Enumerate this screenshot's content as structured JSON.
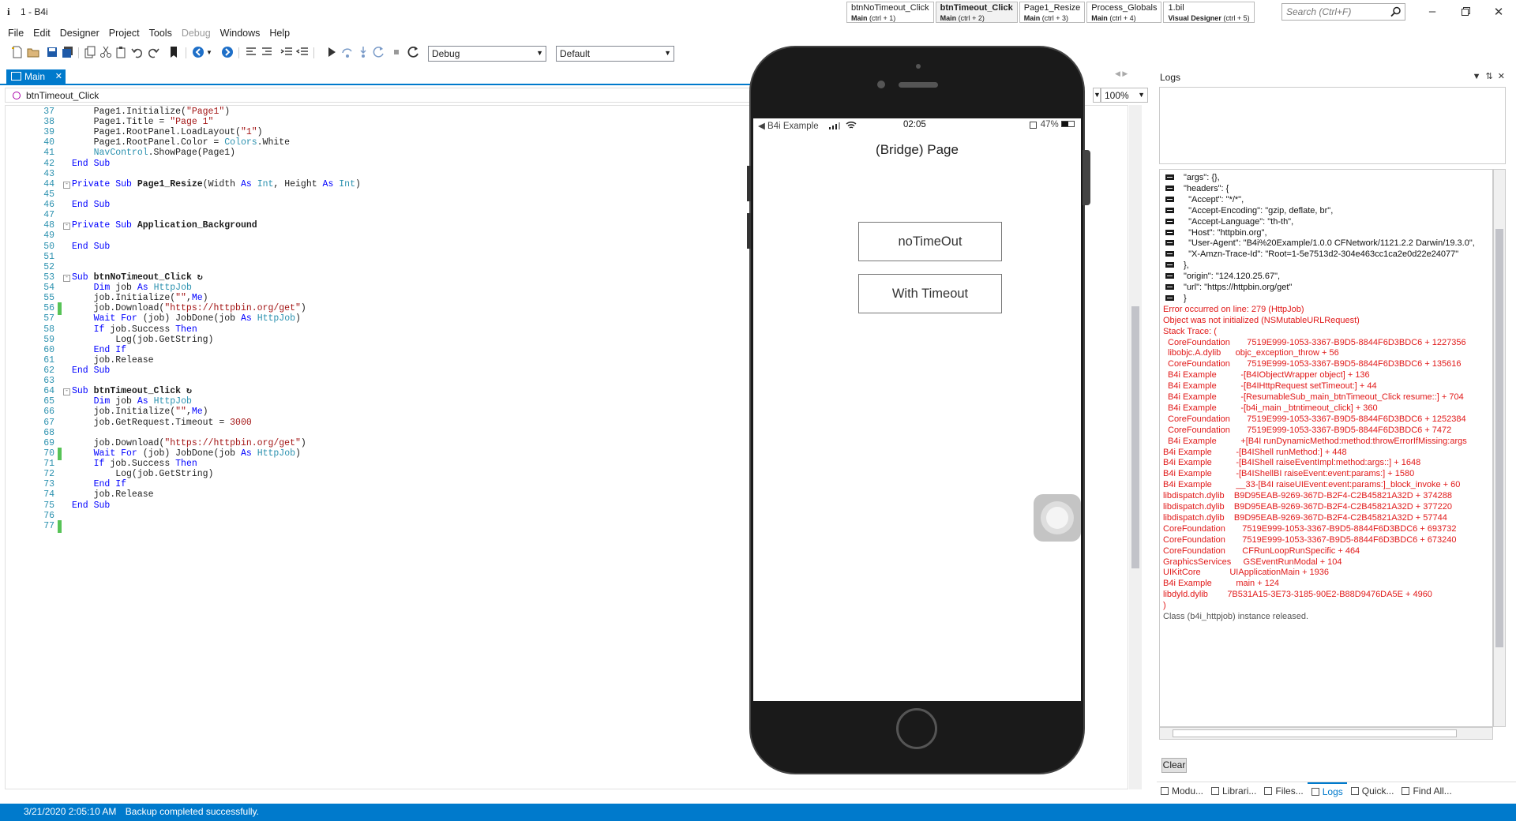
{
  "window": {
    "icon": "i",
    "title": "1 - B4i"
  },
  "quick_tabs": [
    {
      "title": "btnNoTimeout_Click",
      "module": "Main",
      "shortcut": "(ctrl + 1)"
    },
    {
      "title": "btnTimeout_Click",
      "module": "Main",
      "shortcut": "(ctrl + 2)"
    },
    {
      "title": "Page1_Resize",
      "module": "Main",
      "shortcut": "(ctrl + 3)"
    },
    {
      "title": "Process_Globals",
      "module": "Main",
      "shortcut": "(ctrl + 4)"
    },
    {
      "title": "1.bil",
      "module": "Visual Designer",
      "shortcut": "(ctrl + 5)"
    }
  ],
  "search": {
    "placeholder": "Search (Ctrl+F)"
  },
  "menu": [
    "File",
    "Edit",
    "Designer",
    "Project",
    "Tools",
    "Debug",
    "Windows",
    "Help"
  ],
  "toolbar": {
    "build_config": "Debug",
    "platform": "Default"
  },
  "editor": {
    "tab_label": "Main",
    "sub_selector": "btnTimeout_Click",
    "zoom": "100%",
    "lines": [
      {
        "n": "37",
        "t": "    Page1.Initialize(\"Page1\")"
      },
      {
        "n": "38",
        "t": "    Page1.Title = \"Page 1\""
      },
      {
        "n": "39",
        "t": "    Page1.RootPanel.LoadLayout(\"1\")"
      },
      {
        "n": "40",
        "t": "    Page1.RootPanel.Color = Colors.White"
      },
      {
        "n": "41",
        "t": "    NavControl.ShowPage(Page1)"
      },
      {
        "n": "42",
        "t": "End Sub"
      },
      {
        "n": "43",
        "t": ""
      },
      {
        "n": "44",
        "t": "Private Sub Page1_Resize(Width As Int, Height As Int)"
      },
      {
        "n": "45",
        "t": ""
      },
      {
        "n": "46",
        "t": "End Sub"
      },
      {
        "n": "47",
        "t": ""
      },
      {
        "n": "48",
        "t": "Private Sub Application_Background"
      },
      {
        "n": "49",
        "t": ""
      },
      {
        "n": "50",
        "t": "End Sub"
      },
      {
        "n": "51",
        "t": ""
      },
      {
        "n": "52",
        "t": ""
      },
      {
        "n": "53",
        "t": "Sub btnNoTimeout_Click"
      },
      {
        "n": "54",
        "t": "    Dim job As HttpJob"
      },
      {
        "n": "55",
        "t": "    job.Initialize(\"\",Me)"
      },
      {
        "n": "56",
        "t": "    job.Download(\"https://httpbin.org/get\")"
      },
      {
        "n": "57",
        "t": "    Wait For (job) JobDone(job As HttpJob)"
      },
      {
        "n": "58",
        "t": "    If job.Success Then"
      },
      {
        "n": "59",
        "t": "        Log(job.GetString)"
      },
      {
        "n": "60",
        "t": "    End If"
      },
      {
        "n": "61",
        "t": "    job.Release"
      },
      {
        "n": "62",
        "t": "End Sub"
      },
      {
        "n": "63",
        "t": ""
      },
      {
        "n": "64",
        "t": "Sub btnTimeout_Click"
      },
      {
        "n": "65",
        "t": "    Dim job As HttpJob"
      },
      {
        "n": "66",
        "t": "    job.Initialize(\"\",Me)"
      },
      {
        "n": "67",
        "t": "    job.GetRequest.Timeout = 3000"
      },
      {
        "n": "68",
        "t": ""
      },
      {
        "n": "69",
        "t": "    job.Download(\"https://httpbin.org/get\")"
      },
      {
        "n": "70",
        "t": "    Wait For (job) JobDone(job As HttpJob)"
      },
      {
        "n": "71",
        "t": "    If job.Success Then"
      },
      {
        "n": "72",
        "t": "        Log(job.GetString)"
      },
      {
        "n": "73",
        "t": "    End If"
      },
      {
        "n": "74",
        "t": "    job.Release"
      },
      {
        "n": "75",
        "t": "End Sub"
      },
      {
        "n": "76",
        "t": ""
      },
      {
        "n": "77",
        "t": ""
      }
    ]
  },
  "phone": {
    "status_back": "◀ B4i Example",
    "status_time": "02:05",
    "status_battery": "47%",
    "nav_title": "(Bridge) Page",
    "buttons": [
      "noTimeOut",
      "With Timeout"
    ]
  },
  "logs": {
    "title": "Logs",
    "clear_label": "Clear",
    "entries": [
      {
        "k": "ex",
        "t": "\"args\": {},"
      },
      {
        "k": "ex",
        "t": "\"headers\": {"
      },
      {
        "k": "ex",
        "t": "  \"Accept\": \"*/*\","
      },
      {
        "k": "ex",
        "t": "  \"Accept-Encoding\": \"gzip, deflate, br\","
      },
      {
        "k": "ex",
        "t": "  \"Accept-Language\": \"th-th\","
      },
      {
        "k": "ex",
        "t": "  \"Host\": \"httpbin.org\","
      },
      {
        "k": "ex",
        "t": "  \"User-Agent\": \"B4i%20Example/1.0.0 CFNetwork/1121.2.2 Darwin/19.3.0\","
      },
      {
        "k": "ex",
        "t": "  \"X-Amzn-Trace-Id\": \"Root=1-5e7513d2-304e463cc1ca2e0d22e24077\""
      },
      {
        "k": "ex",
        "t": "},"
      },
      {
        "k": "ex",
        "t": "\"origin\": \"124.120.25.67\","
      },
      {
        "k": "ex",
        "t": "\"url\": \"https://httpbin.org/get\""
      },
      {
        "k": "ex",
        "t": "}"
      },
      {
        "k": "err",
        "t": "Error occurred on line: 279 (HttpJob)"
      },
      {
        "k": "err",
        "t": "Object was not initialized (NSMutableURLRequest)"
      },
      {
        "k": "err",
        "t": "Stack Trace: ("
      },
      {
        "k": "erri",
        "t": "CoreFoundation       7519E999-1053-3367-B9D5-8844F6D3BDC6 + 1227356"
      },
      {
        "k": "erri",
        "t": "libobjc.A.dylib      objc_exception_throw + 56"
      },
      {
        "k": "erri",
        "t": "CoreFoundation       7519E999-1053-3367-B9D5-8844F6D3BDC6 + 135616"
      },
      {
        "k": "erri",
        "t": "B4i Example          -[B4IObjectWrapper object] + 136"
      },
      {
        "k": "erri",
        "t": "B4i Example          -[B4IHttpRequest setTimeout:] + 44"
      },
      {
        "k": "erri",
        "t": "B4i Example          -[ResumableSub_main_btnTimeout_Click resume::] + 704"
      },
      {
        "k": "erri",
        "t": "B4i Example          -[b4i_main _btntimeout_click] + 360"
      },
      {
        "k": "erri",
        "t": "CoreFoundation       7519E999-1053-3367-B9D5-8844F6D3BDC6 + 1252384"
      },
      {
        "k": "erri",
        "t": "CoreFoundation       7519E999-1053-3367-B9D5-8844F6D3BDC6 + 7472"
      },
      {
        "k": "erri",
        "t": "B4i Example          +[B4I runDynamicMethod:method:throwErrorIfMissing:args"
      },
      {
        "k": "err",
        "t": "B4i Example          -[B4IShell runMethod:] + 448"
      },
      {
        "k": "err",
        "t": "B4i Example          -[B4IShell raiseEventImpl:method:args::] + 1648"
      },
      {
        "k": "err",
        "t": "B4i Example          -[B4IShellBI raiseEvent:event:params:] + 1580"
      },
      {
        "k": "err",
        "t": "B4i Example          __33-[B4I raiseUIEvent:event:params:]_block_invoke + 60"
      },
      {
        "k": "err",
        "t": "libdispatch.dylib    B9D95EAB-9269-367D-B2F4-C2B45821A32D + 374288"
      },
      {
        "k": "err",
        "t": "libdispatch.dylib    B9D95EAB-9269-367D-B2F4-C2B45821A32D + 377220"
      },
      {
        "k": "err",
        "t": "libdispatch.dylib    B9D95EAB-9269-367D-B2F4-C2B45821A32D + 57744"
      },
      {
        "k": "err",
        "t": "CoreFoundation       7519E999-1053-3367-B9D5-8844F6D3BDC6 + 693732"
      },
      {
        "k": "err",
        "t": "CoreFoundation       7519E999-1053-3367-B9D5-8844F6D3BDC6 + 673240"
      },
      {
        "k": "err",
        "t": "CoreFoundation       CFRunLoopRunSpecific + 464"
      },
      {
        "k": "err",
        "t": "GraphicsServices     GSEventRunModal + 104"
      },
      {
        "k": "err",
        "t": "UIKitCore            UIApplicationMain + 1936"
      },
      {
        "k": "err",
        "t": "B4i Example          main + 124"
      },
      {
        "k": "err",
        "t": "libdyld.dylib        7B531A15-3E73-3185-90E2-B88D9476DA5E + 4960"
      },
      {
        "k": "err",
        "t": ")"
      },
      {
        "k": "info",
        "t": "Class (b4i_httpjob) instance released."
      }
    ]
  },
  "bottom_tabs": [
    "Modu...",
    "Librari...",
    "Files...",
    "Logs",
    "Quick...",
    "Find All..."
  ],
  "status": {
    "timestamp": "3/21/2020 2:05:10 AM",
    "message": "Backup completed successfully."
  },
  "colors": {
    "accent": "#007acc",
    "error": "#e11919",
    "keyword": "#0000ff",
    "type": "#2b91af",
    "string": "#a31515"
  }
}
